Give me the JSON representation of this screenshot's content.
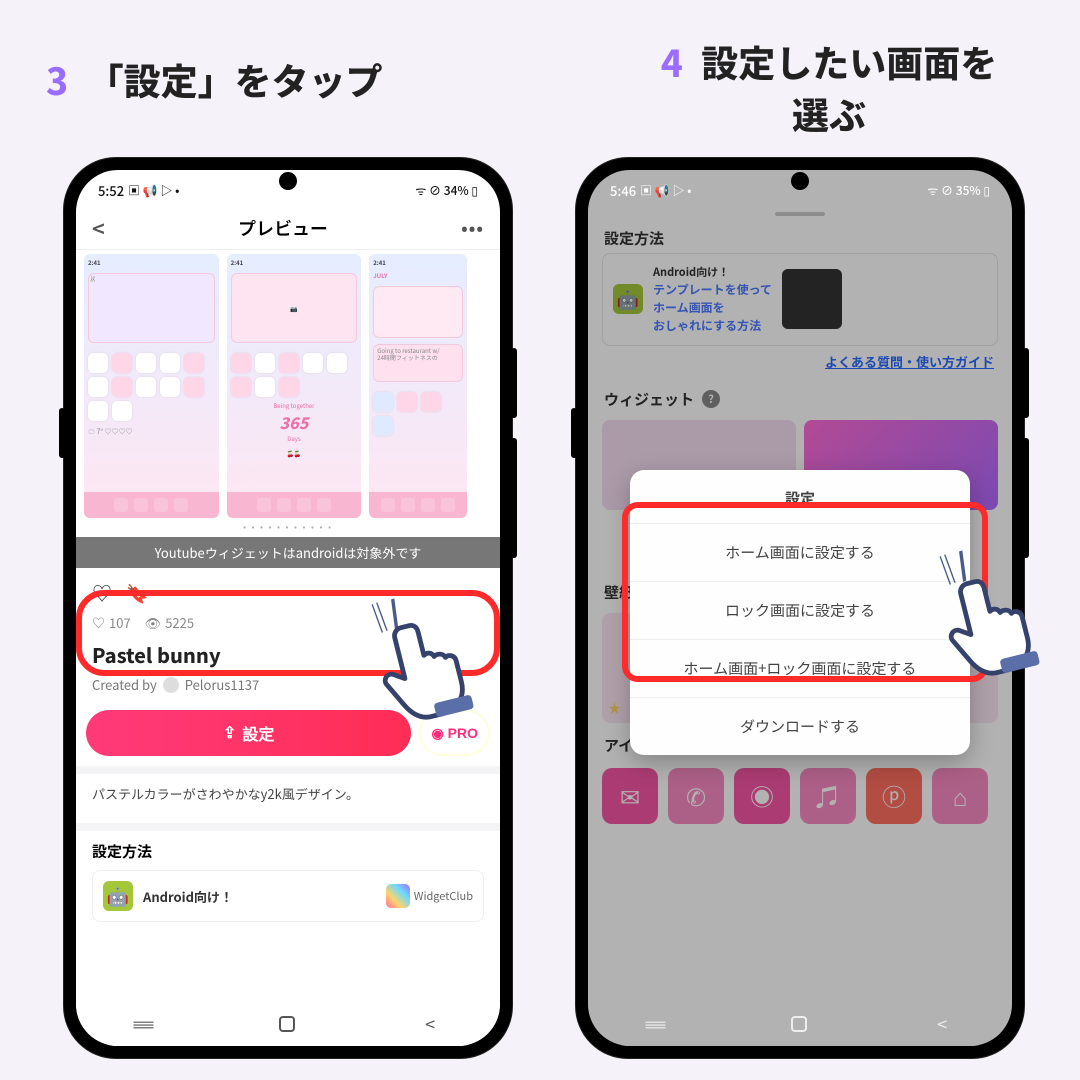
{
  "step3": {
    "num": "3",
    "text": "「設定」をタップ"
  },
  "step4": {
    "num": "4",
    "text": "設定したい画面を\n選ぶ"
  },
  "phone_left": {
    "status": {
      "time": "5:52",
      "icons": "▣ 📢 ▷ •",
      "right": "ᯤ ⊘ 34% ▯"
    },
    "nav": {
      "title": "プレビュー"
    },
    "banner": "Youtubeウィジェットはandroidは対象外です",
    "likes": "107",
    "views": "5225",
    "theme_title": "Pastel bunny",
    "creator_label": "Created by",
    "creator_name": "Pelorus1137",
    "set_label": "設定",
    "pro_label": "PRO",
    "desc": "パステルカラーがさわやかなy2k風デザイン。",
    "section_title": "設定方法",
    "android_label": "Android向け！",
    "widgetclub_label": "WidgetClub",
    "tile_time": "2:41",
    "tile3_month": "JULY",
    "tile2_be": "Being together",
    "tile2_365": "365",
    "tile2_days": "Days"
  },
  "phone_right": {
    "status": {
      "time": "5:46",
      "icons": "▣ 📢 ▷ •",
      "right": "ᯤ ⊘ 35% ▯"
    },
    "section_setup": "設定方法",
    "promo_line1": "Android向け！",
    "promo_line2": "テンプレートを使って",
    "promo_line3": "ホーム画面を",
    "promo_line4": "おしゃれにする方法",
    "faq_link": "よくある質問・使い方ガイド",
    "section_widgets": "ウィジェット",
    "section_wall": "壁紙",
    "section_iconset": "アイコンセット",
    "dialog": {
      "title": "設定",
      "opt1": "ホーム画面に設定する",
      "opt2": "ロック画面に設定する",
      "opt3": "ホーム画面+ロック画面に設定する",
      "opt4": "ダウンロードする"
    }
  }
}
